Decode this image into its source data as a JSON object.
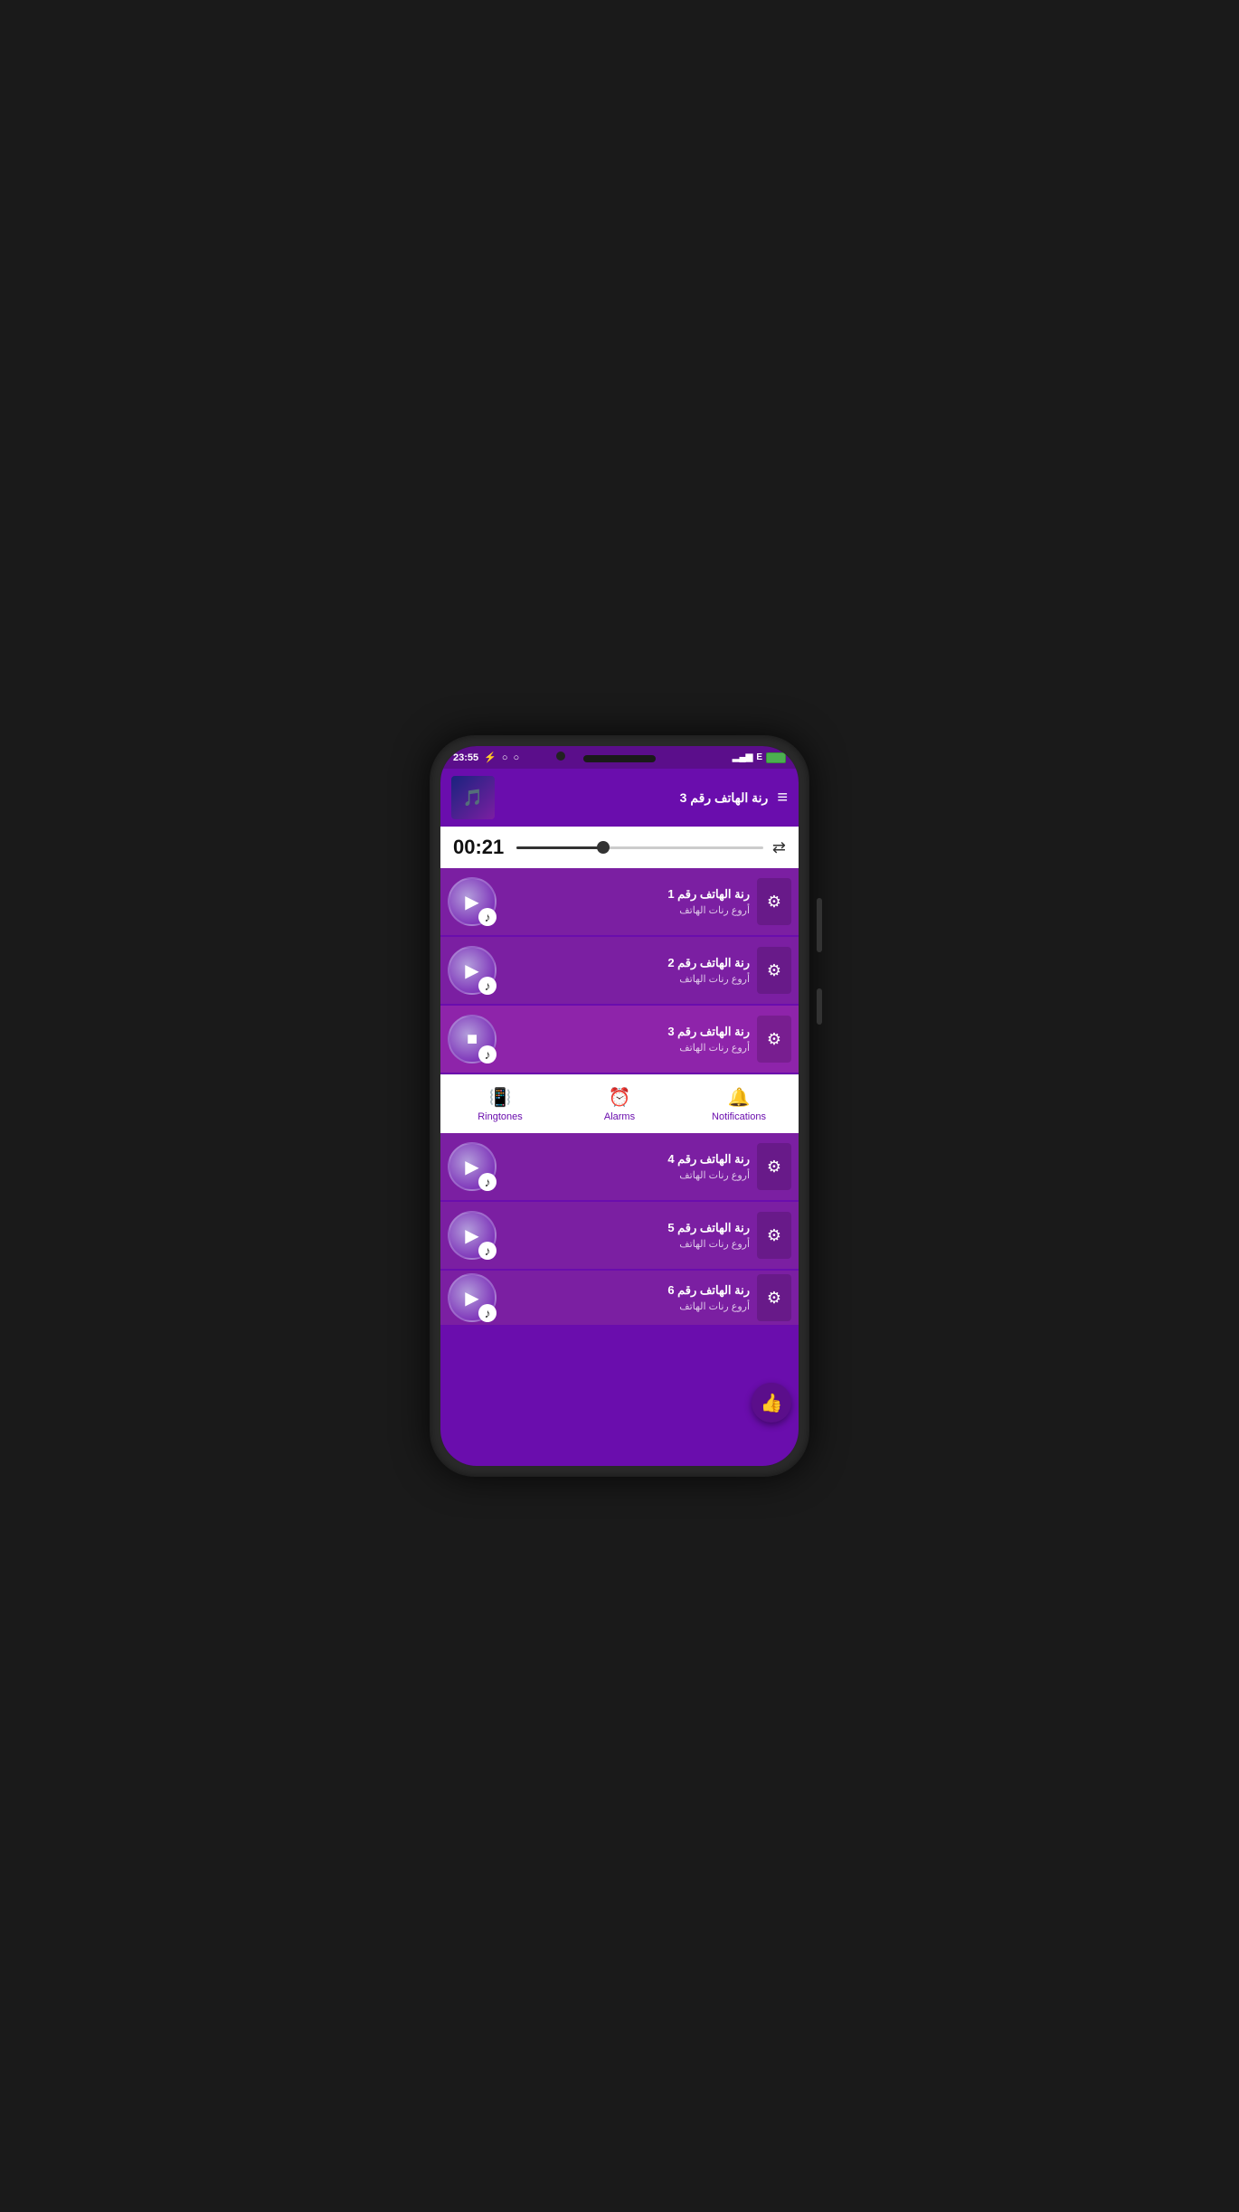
{
  "statusBar": {
    "time": "23:55",
    "signalBars": "▂▄▆",
    "networkType": "E"
  },
  "nowPlaying": {
    "title": "رنة الهاتف رقم 3",
    "time": "00:21",
    "progressPercent": 35
  },
  "tracks": [
    {
      "id": 1,
      "title": "رنة الهاتف رقم 1",
      "subtitle": "أروع رنات الهاتف",
      "playing": false,
      "active": false,
      "icon": "▶"
    },
    {
      "id": 2,
      "title": "رنة الهاتف رقم 2",
      "subtitle": "أروع رنات الهاتف",
      "playing": false,
      "active": false,
      "icon": "▶"
    },
    {
      "id": 3,
      "title": "رنة الهاتف رقم 3",
      "subtitle": "أروع رنات الهاتف",
      "playing": true,
      "active": true,
      "icon": "■"
    },
    {
      "id": 4,
      "title": "رنة الهاتف رقم 4",
      "subtitle": "أروع رنات الهاتف",
      "playing": false,
      "active": false,
      "icon": "▶"
    },
    {
      "id": 5,
      "title": "رنة الهاتف رقم 5",
      "subtitle": "أروع رنات الهاتف",
      "playing": false,
      "active": false,
      "icon": "▶"
    },
    {
      "id": 6,
      "title": "رنة الهاتف رقم 6",
      "subtitle": "أروع رنات الهاتف",
      "playing": false,
      "active": false,
      "icon": "▶"
    }
  ],
  "bottomNav": {
    "items": [
      {
        "id": "ringtones",
        "label": "Ringtones",
        "icon": "📳"
      },
      {
        "id": "alarms",
        "label": "Alarms",
        "icon": "⏰"
      },
      {
        "id": "notifications",
        "label": "Notifications",
        "icon": "🔔"
      }
    ]
  },
  "fab": {
    "icon": "👍"
  }
}
